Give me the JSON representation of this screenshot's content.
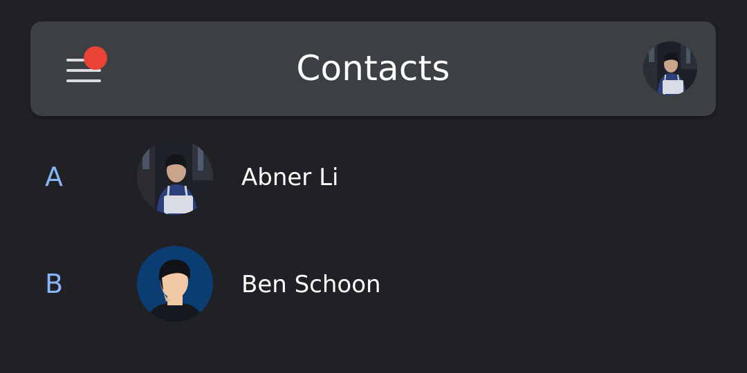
{
  "header": {
    "title": "Contacts",
    "menu_icon": "hamburger-menu-icon",
    "has_notification": true,
    "account_avatar": "user-photo-avatar"
  },
  "contacts": [
    {
      "letter": "A",
      "name": "Abner Li",
      "avatar": "photo-avatar"
    },
    {
      "letter": "B",
      "name": "Ben Schoon",
      "avatar": "illustrated-avatar"
    }
  ],
  "colors": {
    "background": "#202124",
    "top_bar": "#3c4043",
    "letter_accent": "#8ab4f8",
    "notification": "#ea4335",
    "text": "#ffffff"
  }
}
